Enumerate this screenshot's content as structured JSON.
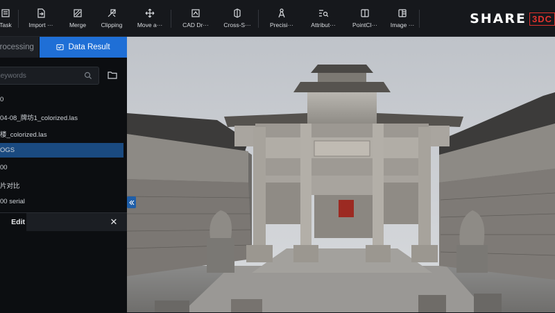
{
  "toolbar": {
    "items": [
      {
        "label": "Task",
        "icon": "task-icon"
      },
      {
        "label": "Import ···",
        "icon": "import-icon"
      },
      {
        "label": "Merge",
        "icon": "merge-icon"
      },
      {
        "label": "Clipping",
        "icon": "clipping-icon"
      },
      {
        "label": "Move a···",
        "icon": "move-icon"
      },
      {
        "label": "CAD Dr···",
        "icon": "cad-drawing-icon"
      },
      {
        "label": "Cross-S···",
        "icon": "cross-section-icon"
      },
      {
        "label": "Precisi···",
        "icon": "precision-icon"
      },
      {
        "label": "Attribut···",
        "icon": "attribute-icon"
      },
      {
        "label": "PointCl···",
        "icon": "pointcloud-icon"
      },
      {
        "label": "Image ···",
        "icon": "image-icon"
      }
    ],
    "logo_text": "SHARE",
    "logo_box": "3DC"
  },
  "sidebar": {
    "tabs": [
      {
        "label": "Processing",
        "active": false
      },
      {
        "label": "Data Result",
        "active": true,
        "icon": "data-result-icon"
      }
    ],
    "search_placeholder": "Keywords",
    "files": [
      {
        "label": "0",
        "selected": false
      },
      {
        "label": "04-08_牌坊1_colorized.las",
        "selected": false
      },
      {
        "label": "楼_colorized.las",
        "selected": false
      },
      {
        "label": "OGS",
        "selected": true
      },
      {
        "label": "00",
        "selected": false
      },
      {
        "label": "片对比",
        "selected": false
      },
      {
        "label": "00 serial",
        "selected": false
      }
    ],
    "edit_panel": {
      "tab_label": "Edit",
      "close_icon": "close-icon"
    }
  },
  "colors": {
    "accent": "#1f6fd6",
    "selection": "#1a4a80",
    "logo_red": "#e0322d"
  }
}
